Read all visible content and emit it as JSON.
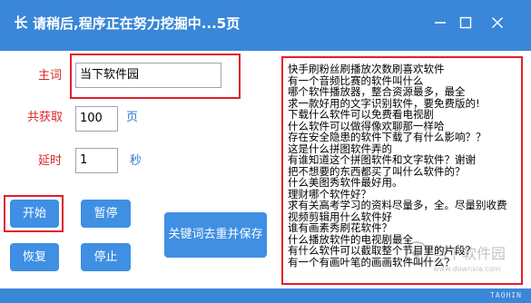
{
  "window": {
    "icon_glyph": "长",
    "title": "请稍后,程序正在努力挖掘中...5页",
    "minimize_icon": "minimize-icon",
    "maximize_icon": "maximize-icon",
    "close_icon": "close-icon"
  },
  "form": {
    "keyword_label": "主词",
    "keyword_value": "当下软件园",
    "count_label": "共获取",
    "count_value": "100",
    "count_unit": "页",
    "delay_label": "延时",
    "delay_value": "1",
    "delay_unit": "秒"
  },
  "buttons": {
    "start": "开始",
    "pause": "暂停",
    "dedupe_save": "关键词去重并保存",
    "resume": "恢复",
    "stop": "停止"
  },
  "results": [
    "快手刷粉丝刷播放次数刷喜欢软件",
    "有一个音频比赛的软件叫什么",
    "哪个软件播放器，整合资源最多，最全",
    "求一款好用的文字识别软件，要免费版的!",
    "下载什么软件可以免费看电视剧",
    "什么软件可以做得像欢聊那一样哈",
    "存在安全隐患的软件下载了有什么影响？？",
    "这是什么拼图软件弄的",
    "有谁知道这个拼图软件和文字软件？谢谢",
    "把不想要的东西都买了叫什么软件的？",
    "什么美图秀软件最好用。",
    "理财哪个软件好？",
    "求有关高考学习的资料尽量多，全。尽量别收费",
    "视频剪辑用什么软件好",
    "谁有画素秀刷花软件？",
    "什么播放软件的电视剧最全",
    "有什么软件可以截取整个节目里的片段？",
    "有一个有画叶笔的画画软件叫什么？"
  ],
  "watermark": {
    "text": "当下软件园",
    "subtext": "www.downxia.com"
  },
  "statusbar": {
    "tag": "TAOHIN"
  },
  "colors": {
    "titlebar": "#3a86d8",
    "button": "#3f8fe3",
    "highlight_frame": "#e21e2a",
    "label_red": "#d82626",
    "label_blue": "#2e78d0"
  }
}
